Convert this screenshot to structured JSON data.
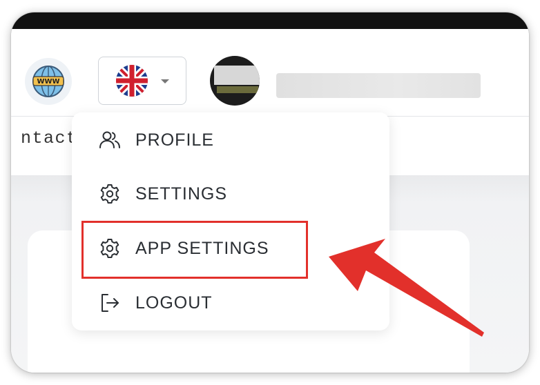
{
  "header": {
    "web_icon": "www-globe-icon",
    "language": {
      "selected_flag": "uk-flag-icon",
      "caret": "chevron-down-icon"
    },
    "avatar": "user-avatar"
  },
  "nav": {
    "contact_label": "ntact"
  },
  "menu": {
    "items": [
      {
        "label": "PROFILE",
        "icon": "users-icon"
      },
      {
        "label": "SETTINGS",
        "icon": "gear-icon"
      },
      {
        "label": "APP SETTINGS",
        "icon": "gear-icon"
      },
      {
        "label": "LOGOUT",
        "icon": "logout-icon"
      }
    ]
  },
  "annotation": {
    "highlight_color": "#e2302b",
    "arrow_color": "#e2302b"
  }
}
